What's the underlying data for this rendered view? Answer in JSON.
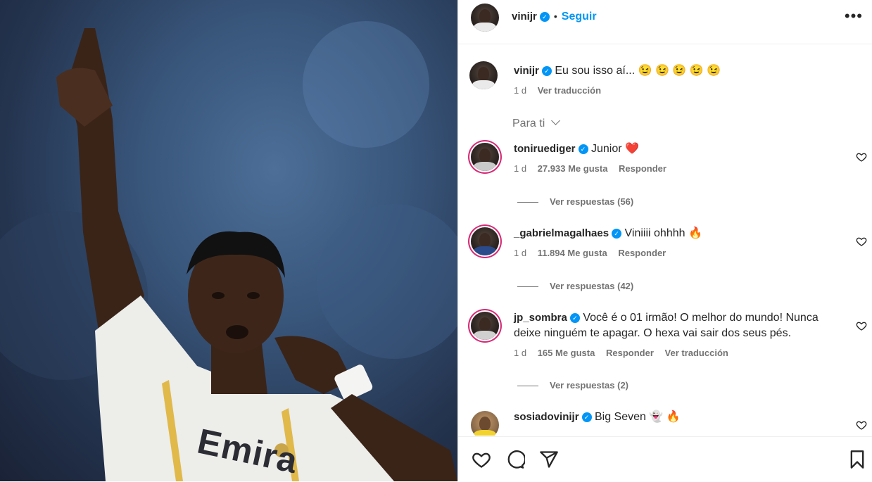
{
  "post": {
    "username": "vinijr",
    "follow_label": "Seguir",
    "separator": "•",
    "more_icon": "more-horizontal-icon"
  },
  "caption": {
    "username": "vinijr",
    "text": "Eu sou isso aí...",
    "emojis": "😉 😉 😉 😉 😉",
    "time": "1 d",
    "translate": "Ver traducción"
  },
  "sort": {
    "label": "Para ti"
  },
  "comments": [
    {
      "username": "toniruediger",
      "text": "Junior",
      "emoji": "❤️",
      "time": "1 d",
      "likes": "27.933 Me gusta",
      "reply": "Responder",
      "translate": "",
      "replies": "Ver respuestas (56)"
    },
    {
      "username": "_gabrielmagalhaes",
      "text": "Viniiii ohhhh",
      "emoji": "🔥",
      "time": "1 d",
      "likes": "11.894 Me gusta",
      "reply": "Responder",
      "translate": "",
      "replies": "Ver respuestas (42)"
    },
    {
      "username": "jp_sombra",
      "text": "Você é o 01 irmão! O melhor do mundo! Nunca deixe ninguém te apagar. O hexa vai sair dos seus pés.",
      "emoji": "",
      "time": "1 d",
      "likes": "165 Me gusta",
      "reply": "Responder",
      "translate": "Ver traducción",
      "replies": "Ver respuestas (2)"
    },
    {
      "username": "sosiadovinijr",
      "text": "Big Seven",
      "emoji": "👻 🔥",
      "time": "",
      "likes": "",
      "reply": "",
      "translate": "",
      "replies": ""
    }
  ],
  "photo": {
    "jersey_text": "Emira"
  },
  "colors": {
    "accent": "#0095f6",
    "secondary_text": "#737373",
    "ring": "#d62976"
  }
}
